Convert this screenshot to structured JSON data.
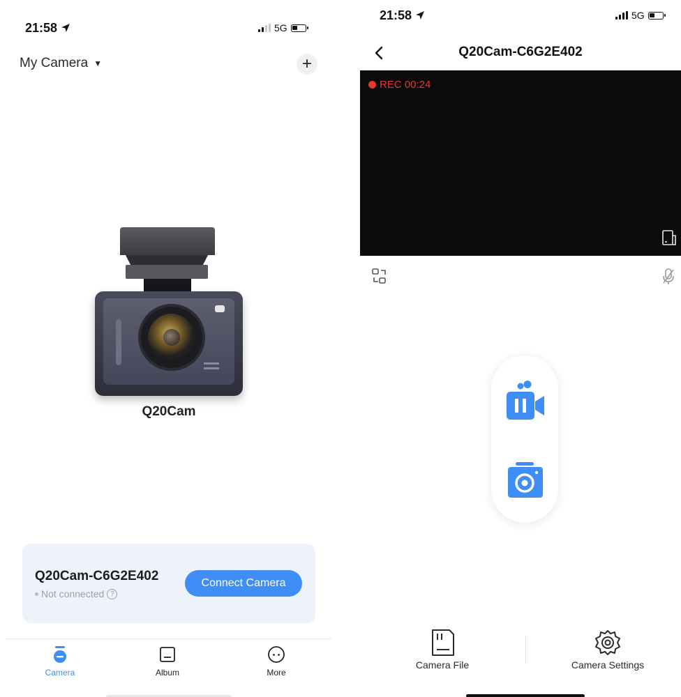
{
  "colors": {
    "accent": "#3f8ef6",
    "record": "#e23a2d",
    "card_bg": "#eef3fb"
  },
  "left": {
    "status": {
      "time": "21:58",
      "network": "5G"
    },
    "header": {
      "title": "My Camera",
      "add_icon": "plus-icon"
    },
    "device": {
      "name": "Q20Cam"
    },
    "card": {
      "device_id": "Q20Cam-C6G2E402",
      "status": "Not connected",
      "connect_label": "Connect Camera"
    },
    "tabs": [
      {
        "label": "Camera",
        "icon": "camera-tab-icon",
        "active": true
      },
      {
        "label": "Album",
        "icon": "album-icon",
        "active": false
      },
      {
        "label": "More",
        "icon": "more-icon",
        "active": false
      }
    ]
  },
  "right": {
    "status": {
      "time": "21:58",
      "network": "5G"
    },
    "title": "Q20Cam-C6G2E402",
    "rec": {
      "label": "REC 00:24"
    },
    "bottom": {
      "file_label": "Camera File",
      "settings_label": "Camera Settings"
    }
  }
}
